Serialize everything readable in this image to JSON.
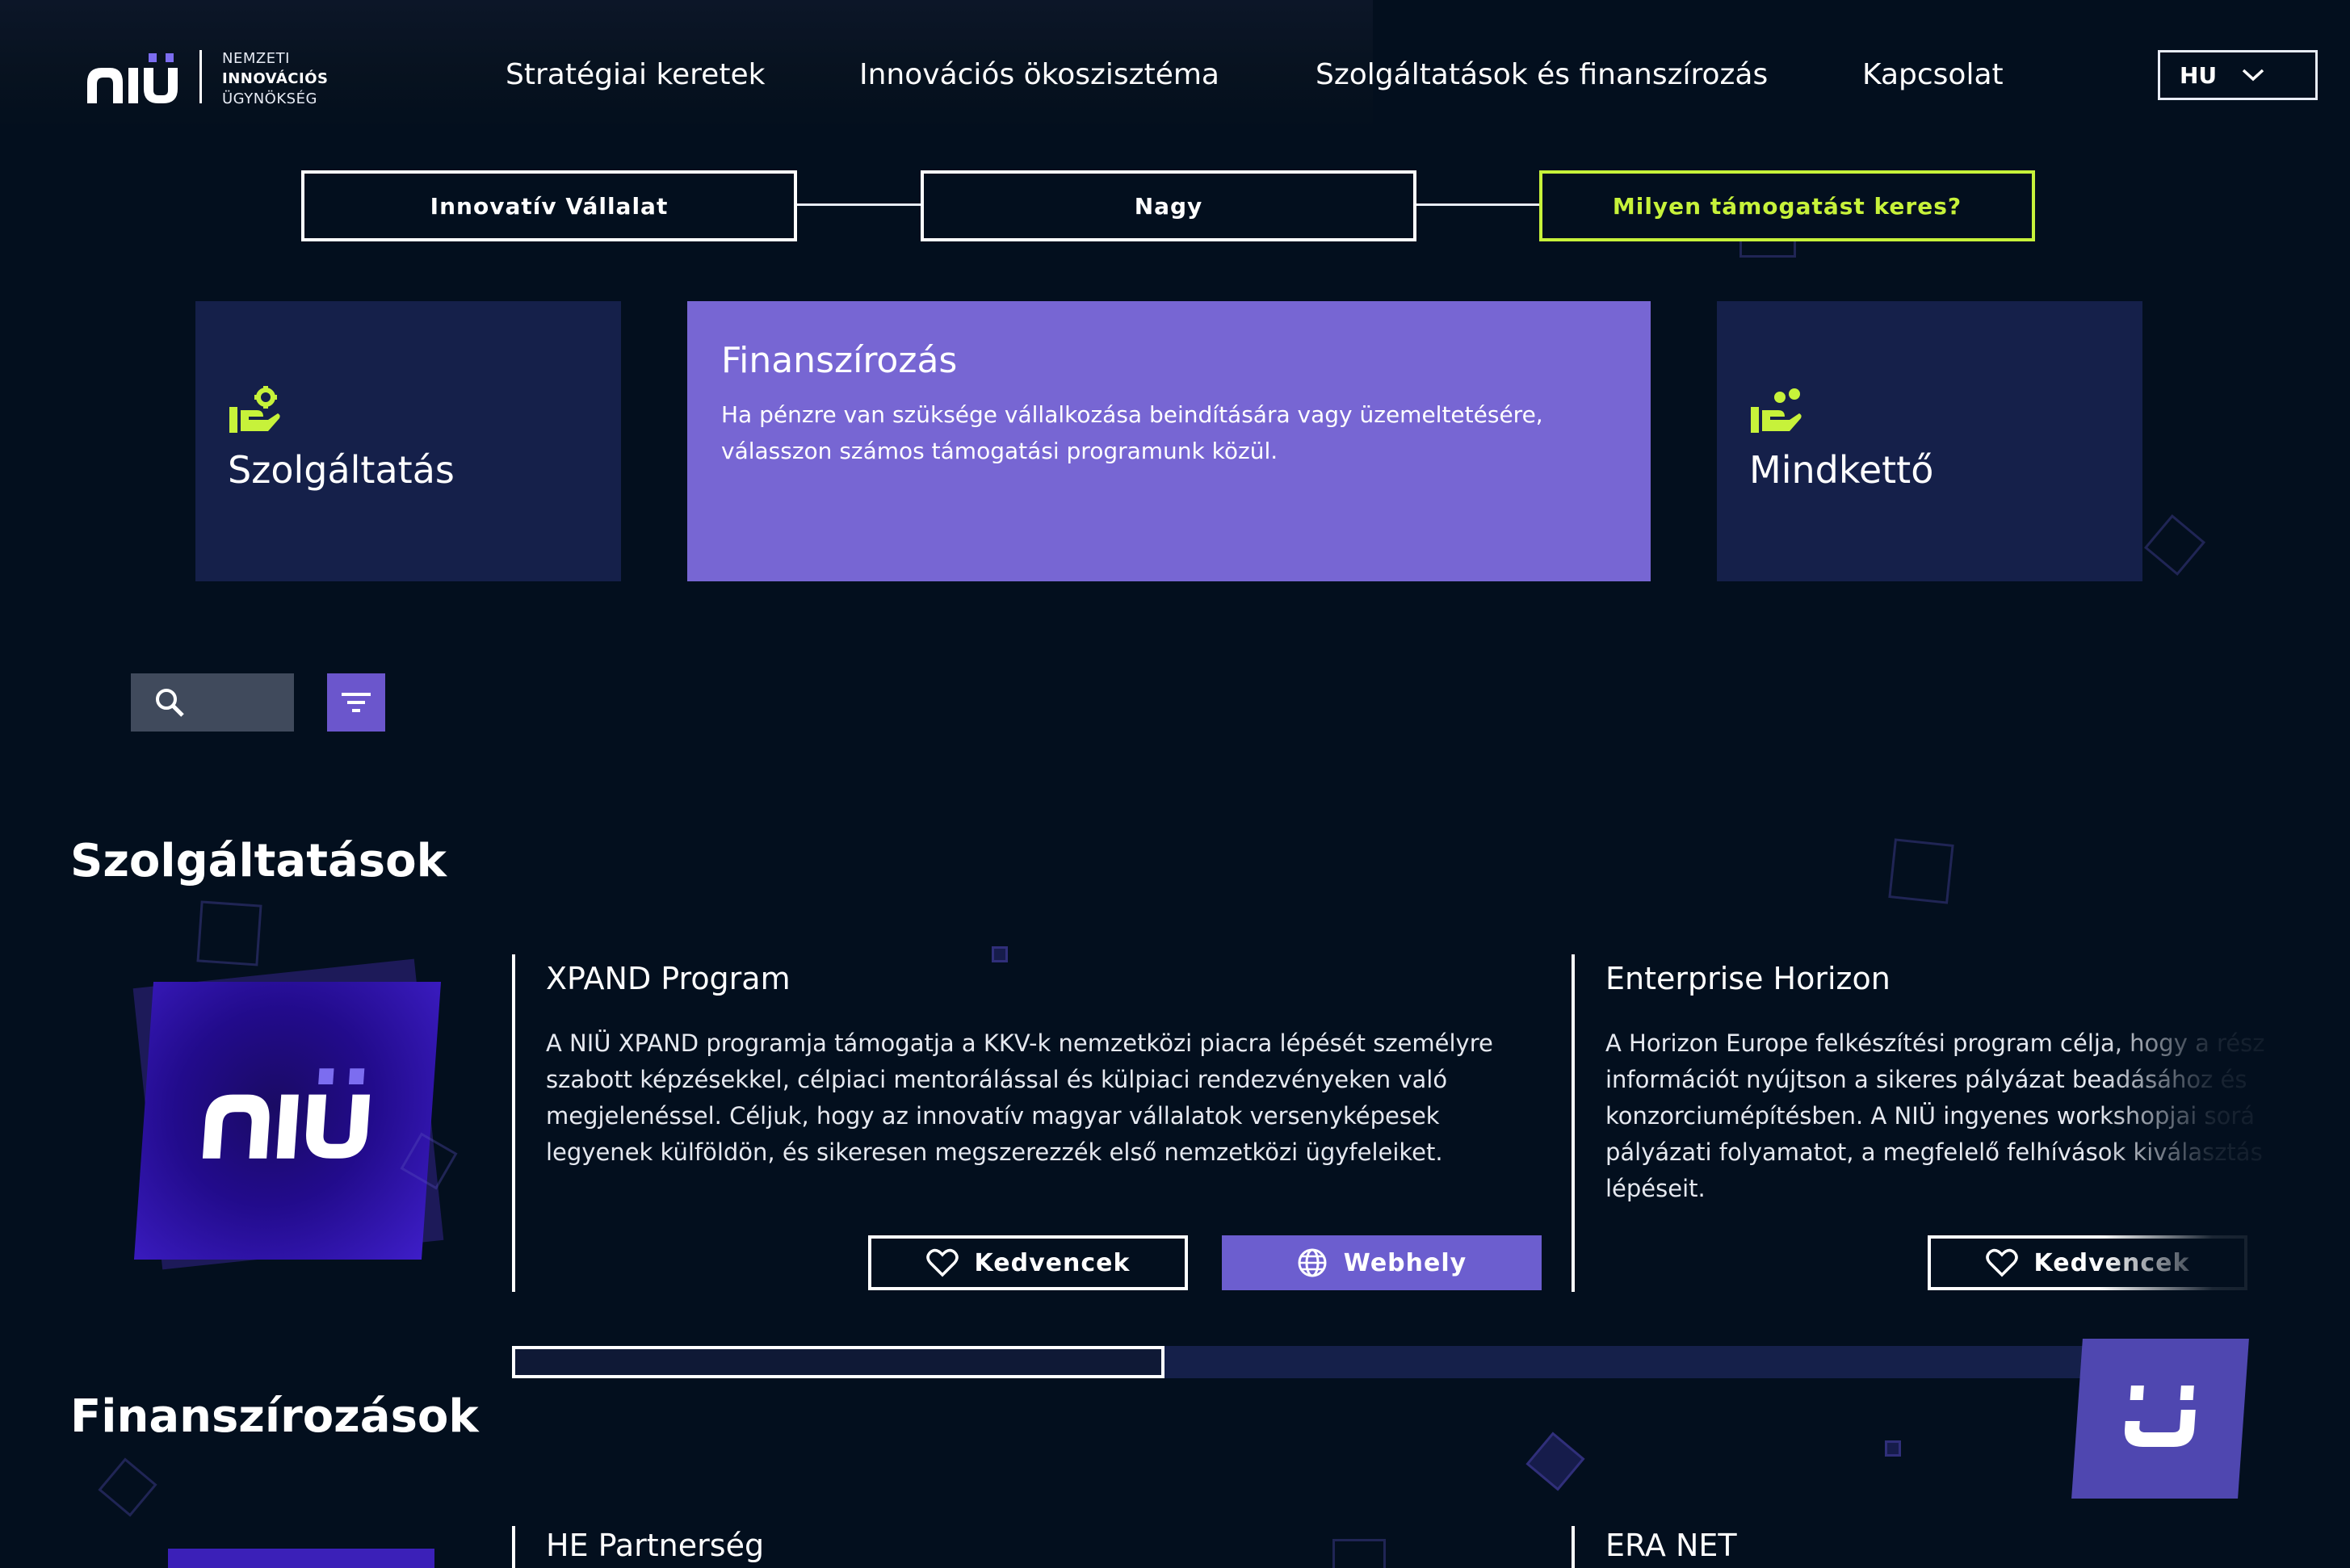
{
  "brand": {
    "logo_lines": [
      "NEMZETI",
      "INNOVÁCIÓS",
      "ÜGYNÖKSÉG"
    ],
    "accent_color": "#c7f23a",
    "primary_color": "#7766d3"
  },
  "nav": {
    "items": [
      {
        "label": "Stratégiai keretek"
      },
      {
        "label": "Innovációs ökoszisztéma"
      },
      {
        "label": "Szolgáltatások és finanszírozás"
      },
      {
        "label": "Kapcsolat"
      }
    ],
    "language": "HU"
  },
  "stepper": {
    "steps": [
      {
        "label": "Innovatív Vállalat"
      },
      {
        "label": "Nagy"
      },
      {
        "label": "Milyen támogatást keres?"
      }
    ]
  },
  "options": {
    "service": {
      "label": "Szolgáltatás",
      "icon": "hand-gear-icon"
    },
    "funding": {
      "title": "Finanszírozás",
      "desc": "Ha pénzre van szüksége vállalkozása beindítására vagy  üzemeltetésére, válasszon számos támogatási programunk közül."
    },
    "both": {
      "label": "Mindkettő",
      "icon": "hand-coins-icon"
    }
  },
  "search": {
    "placeholder": ""
  },
  "sections": {
    "services_title": "Szolgáltatások",
    "funding_title": "Finanszírozások"
  },
  "services": [
    {
      "title": "XPAND Program",
      "desc": "A NIÜ XPAND programja támogatja a KKV-k nemzetközi piacra lépését személyre szabott képzésekkel, célpiaci mentorálással és külpiaci rendezvényeken való megjelenéssel. Céljuk, hogy az innovatív magyar vállalatok versenyképesek legyenek külföldön, és sikeresen megszerezzék első nemzetközi ügyfeleiket.",
      "fav_label": "Kedvencek",
      "web_label": "Webhely"
    },
    {
      "title": "Enterprise Horizon",
      "desc": "A Horizon Europe felkészítési program célja, hogy a rész információt nyújtson a sikeres pályázat beadásához és konzorciumépítésben. A NIÜ ingyenes workshopjai sorá pályázati folyamatot, a megfelelő felhívások kiválasztás lépéseit.",
      "fav_label": "Kedvencek"
    }
  ],
  "scroll": {
    "visible_fraction": 0.39
  },
  "funding_items": [
    {
      "title": "HE Partnerség"
    },
    {
      "title": "ERA NET"
    }
  ]
}
